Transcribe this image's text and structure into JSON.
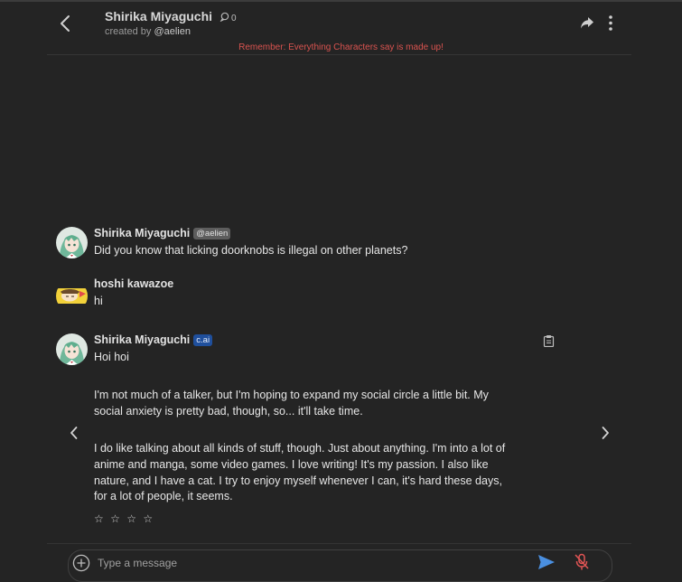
{
  "header": {
    "character_name": "Shirika Miyaguchi",
    "chat_count": "0",
    "created_by_prefix": "created by",
    "creator_handle": "@aelien",
    "disclaimer": "Remember: Everything Characters say is made up!"
  },
  "messages": [
    {
      "author": "Shirika Miyaguchi",
      "badge": "@aelien",
      "text": "Did you know that licking doorknobs is illegal on other planets?"
    },
    {
      "author": "hoshi kawazoe",
      "text": "hi"
    },
    {
      "author": "Shirika Miyaguchi",
      "badge": "c.ai",
      "paragraphs": [
        [
          "Hoi hoi"
        ],
        [
          "I'm not much of a talker, but I'm hoping to expand my social circle a little bit. My",
          "social anxiety is pretty bad, though, so... it'll take time."
        ],
        [
          "I do like talking about all kinds of stuff, though. Just about anything. I'm into a lot of",
          "anime and manga, some video games. I love writing! It's my passion. I also like",
          "nature, and I have a cat. I try to enjoy myself whenever I can, it's hard these days,",
          "for a lot of people, it seems."
        ]
      ]
    }
  ],
  "rating": {
    "stars": [
      "☆",
      "☆",
      "☆",
      "☆"
    ]
  },
  "composer": {
    "placeholder": "Type a message"
  },
  "icons": {
    "back": "chevron-left-icon",
    "chat_count": "chat-bubble-icon",
    "share": "share-arrow-icon",
    "menu": "kebab-menu-icon",
    "copy": "clipboard-icon",
    "prev": "chevron-left-icon",
    "next": "chevron-right-icon",
    "add": "plus-circle-icon",
    "send": "send-icon",
    "mic": "mic-off-icon"
  },
  "colors": {
    "background": "#242424",
    "disclaimer": "#d9534f",
    "cai_badge": "#1f4f9c",
    "send": "#4a8fe0",
    "mic_off": "#e25555"
  }
}
